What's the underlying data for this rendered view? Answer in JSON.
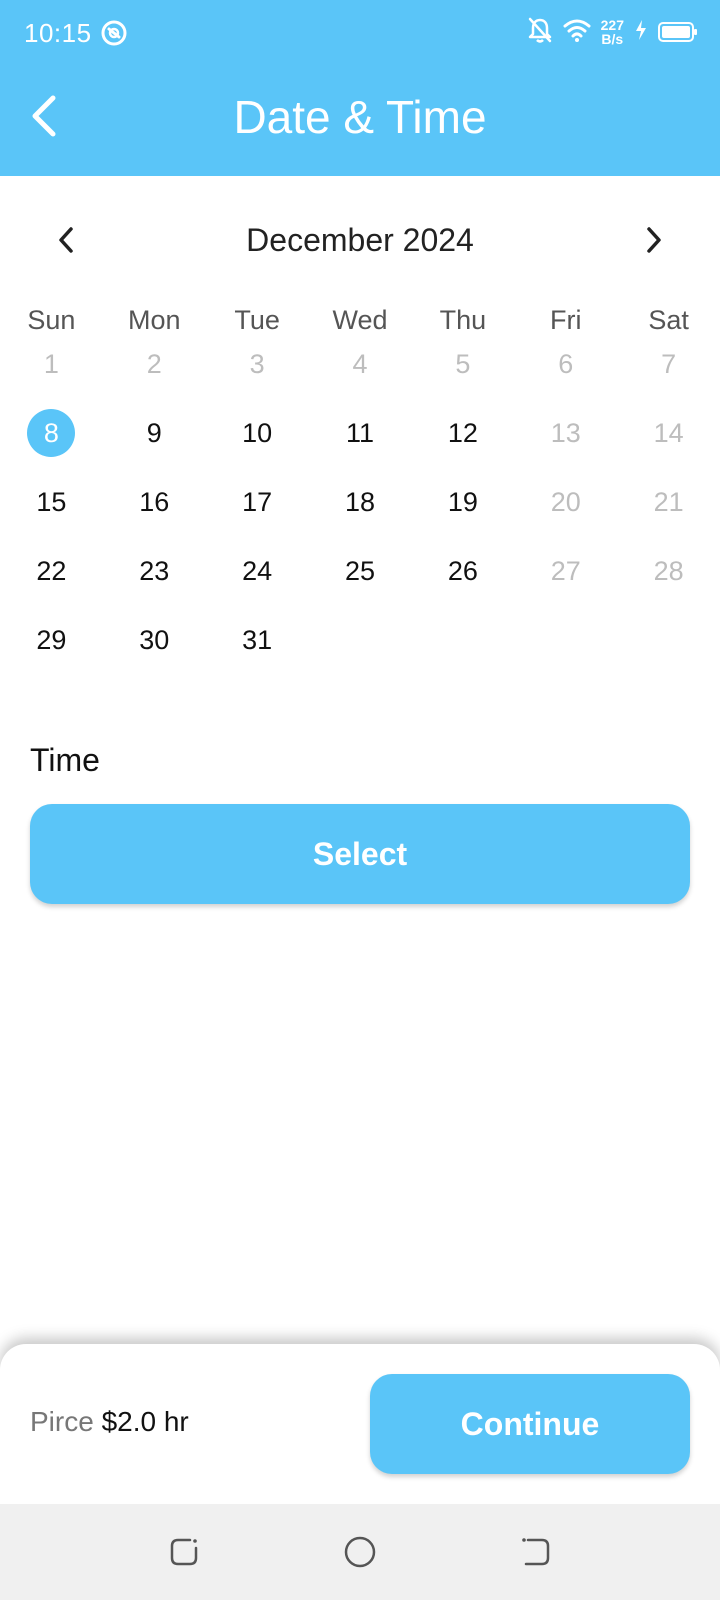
{
  "status_bar": {
    "time": "10:15",
    "net_speed_value": "227",
    "net_speed_unit": "B/s",
    "icons": [
      "sync-icon",
      "bell-off-icon",
      "wifi-icon",
      "charging-icon",
      "battery-icon"
    ]
  },
  "header": {
    "title": "Date & Time",
    "back_icon": "chevron-left-icon"
  },
  "calendar": {
    "month_label": "December 2024",
    "weekdays": [
      "Sun",
      "Mon",
      "Tue",
      "Wed",
      "Thu",
      "Fri",
      "Sat"
    ],
    "selected_day": "8",
    "weeks": [
      [
        {
          "d": "1",
          "muted": true
        },
        {
          "d": "2",
          "muted": true
        },
        {
          "d": "3",
          "muted": true
        },
        {
          "d": "4",
          "muted": true
        },
        {
          "d": "5",
          "muted": true
        },
        {
          "d": "6",
          "muted": true
        },
        {
          "d": "7",
          "muted": true
        }
      ],
      [
        {
          "d": "8",
          "selected": true
        },
        {
          "d": "9"
        },
        {
          "d": "10"
        },
        {
          "d": "11"
        },
        {
          "d": "12"
        },
        {
          "d": "13",
          "muted": true
        },
        {
          "d": "14",
          "muted": true
        }
      ],
      [
        {
          "d": "15"
        },
        {
          "d": "16"
        },
        {
          "d": "17"
        },
        {
          "d": "18"
        },
        {
          "d": "19"
        },
        {
          "d": "20",
          "muted": true
        },
        {
          "d": "21",
          "muted": true
        }
      ],
      [
        {
          "d": "22"
        },
        {
          "d": "23"
        },
        {
          "d": "24"
        },
        {
          "d": "25"
        },
        {
          "d": "26"
        },
        {
          "d": "27",
          "muted": true
        },
        {
          "d": "28",
          "muted": true
        }
      ],
      [
        {
          "d": "29"
        },
        {
          "d": "30"
        },
        {
          "d": "31"
        },
        {
          "d": ""
        },
        {
          "d": ""
        },
        {
          "d": ""
        },
        {
          "d": ""
        }
      ]
    ]
  },
  "time_section": {
    "label": "Time",
    "select_label": "Select"
  },
  "footer": {
    "price_label": "Pirce",
    "price_value": "$2.0 hr",
    "continue_label": "Continue"
  },
  "theme": {
    "accent": "#5ac5f8",
    "muted_text": "#bdbdbd"
  }
}
